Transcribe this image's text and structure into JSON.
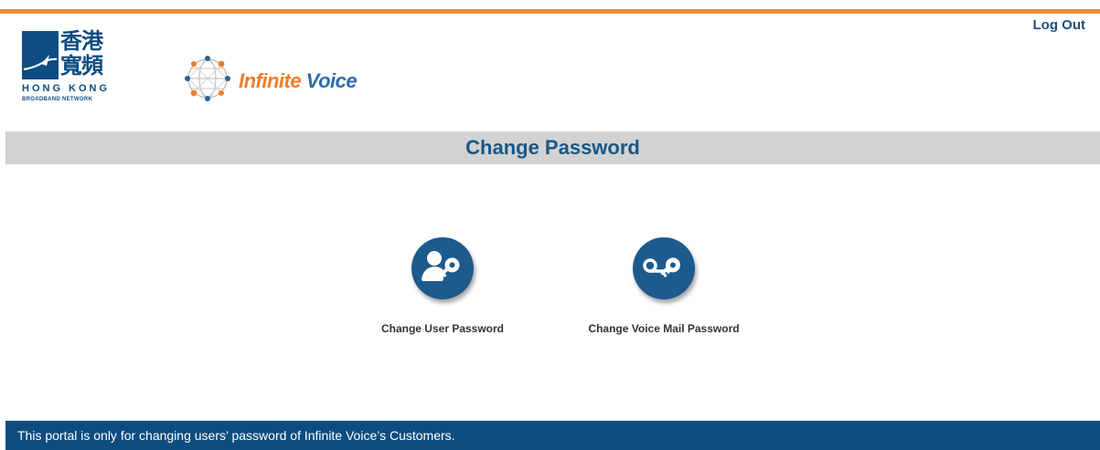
{
  "header": {
    "logout_label": "Log Out",
    "hkbn_logo": {
      "chinese": "香港寬頻",
      "name_line1": "HONG KONG",
      "name_line2": "BROADBAND NETWORK"
    },
    "product_logo": {
      "word1": "Infinite",
      "word2": "Voice"
    }
  },
  "main": {
    "title": "Change Password",
    "options": [
      {
        "label": "Change User Password",
        "icon": "user-key-icon"
      },
      {
        "label": "Change Voice Mail Password",
        "icon": "voicemail-key-icon"
      }
    ]
  },
  "footer": {
    "text": "This portal is only for changing users’ password of Infinite Voice’s Customers."
  },
  "colors": {
    "accent_orange": "#ee8a3a",
    "brand_blue": "#0d4c7f",
    "title_bar_gray": "#d2d2d2"
  }
}
